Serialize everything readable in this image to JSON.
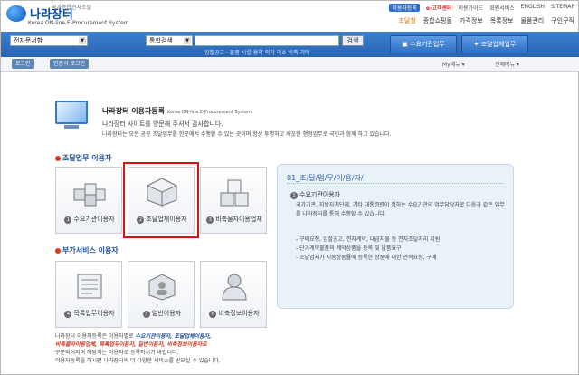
{
  "header": {
    "logo_name": "나라장터",
    "logo_sub": "국가종합전자조달",
    "logo_sub2": "Korea ON-line E-Procurement System",
    "util": [
      "이용자등록",
      "e-고객센터",
      "이용가이드",
      "회원서비스",
      "ENGLISH",
      "SITEMAP"
    ],
    "gnb": [
      "조달청",
      "종합쇼핑몰",
      "가격정보",
      "목록정보",
      "물품관리",
      "구인구직"
    ]
  },
  "searchbar": {
    "category": "전자문서함",
    "search_type": "통합검색",
    "search_value": "",
    "search_button": "검색",
    "quick_links": "입찰공고 · 물품 시설 용역 외자 리스 비축 기타",
    "btn_buyer": "수요기관업무",
    "btn_supplier": "조달업체업무"
  },
  "subbar": {
    "tab1": "로그인",
    "tab2": "인증서 로그인",
    "menu1": "My메뉴 ▾",
    "menu2": "전체메뉴 ▾"
  },
  "intro": {
    "title": "나라장터 이용자등록",
    "title_en": "Korea ON-line E-Procurement System",
    "line1": "나라장터 사이트를 방문해 주셔서 감사합니다.",
    "line2": "나라장터는 모든 공공 조달업무를 한곳에서 수행할 수 있는 곳이며 항상 투명하고 깨끗한 행정업무로 국민과 함께 하고 있습니다."
  },
  "sections": {
    "s1": "조달업무 이용자",
    "s2": "부가서비스 이용자"
  },
  "cards": [
    {
      "num": "1",
      "label": "수요기관이용자",
      "icon": "puzzle-blocks-icon"
    },
    {
      "num": "2",
      "label": "조달업체이용자",
      "icon": "cube-icon"
    },
    {
      "num": "3",
      "label": "비축물자이용업체",
      "icon": "stacked-boxes-icon"
    },
    {
      "num": "4",
      "label": "목록업무이용자",
      "icon": "catalog-icon"
    },
    {
      "num": "5",
      "label": "일반이용자",
      "icon": "user-cube-icon"
    },
    {
      "num": "6",
      "label": "비축정보이용자",
      "icon": "user-silhouette-icon"
    }
  ],
  "notes": {
    "l1a": "나라장터 이용자등록은 이용자별로 ",
    "l1b": "수요기관이용자, 조달업체이용자,",
    "l2": "비축물자이용업체, 목록업무이용자, 일반이용자, 비축정보이용자로",
    "l3": "구분되어지며 해당하는 이용자로 등록하시기 바랍니다.",
    "l4": "이용자등록을 하시면 나라장터의 더 다양한 서비스를 받으실 수 있습니다."
  },
  "panel": {
    "heading": "01_조/달/업/무/이/용/자/",
    "sub_num": "1",
    "sub_title": "수요기관이용자",
    "text": "국가기관, 지방자치단체, 기타 대통령령이 정하는 수요기관의 업무담당자로 다음과 같은 업무를 나라장터를 통해 수행할 수 있습니다.",
    "items": [
      "- 구매요청, 입찰공고, 전자계약, 대금지불 등 전자조달처리 지원",
      "- 단가계약물품의 계약상품을 등록 및 납품요구",
      "- 조달업체가 시중상품률에 등록한 상품에 대한 견적요청, 구매"
    ]
  }
}
